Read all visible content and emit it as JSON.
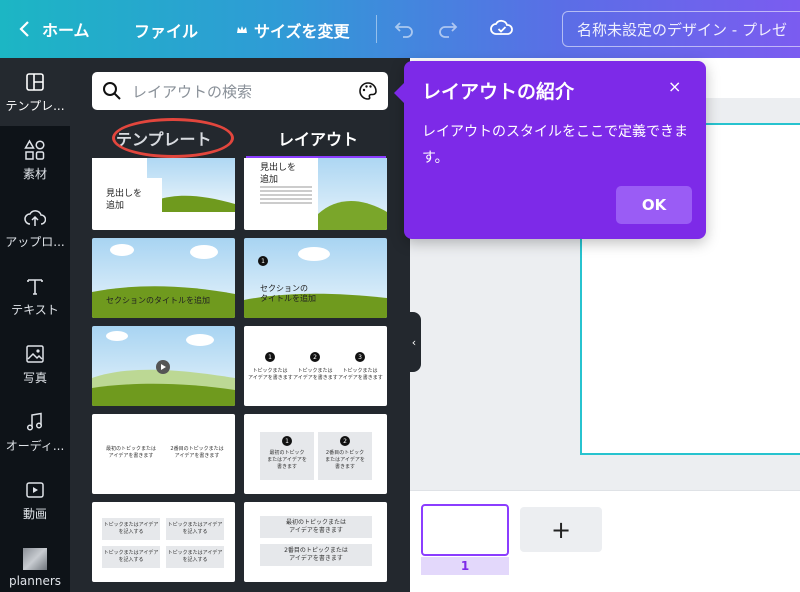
{
  "topbar": {
    "home": "ホーム",
    "file": "ファイル",
    "resize": "サイズを変更",
    "title": "名称未設定のデザイン - プレゼ"
  },
  "nav": {
    "items": [
      {
        "label": "テンプレ...",
        "icon": "layout-icon"
      },
      {
        "label": "素材",
        "icon": "shapes-icon"
      },
      {
        "label": "アップロ...",
        "icon": "upload-cloud-icon"
      },
      {
        "label": "テキスト",
        "icon": "text-icon"
      },
      {
        "label": "写真",
        "icon": "photo-icon"
      },
      {
        "label": "オーディ...",
        "icon": "music-note-icon"
      },
      {
        "label": "動画",
        "icon": "video-icon"
      },
      {
        "label": "planners",
        "icon": "folder-thumbnail"
      }
    ]
  },
  "panel": {
    "search_placeholder": "レイアウトの検索",
    "tab_templates": "テンプレート",
    "tab_layouts": "レイアウト",
    "cards": {
      "c1": "見出しを\n追加",
      "c2": "見出しを\n追加",
      "c3": "セクションのタイトルを追加",
      "c4_num": "1",
      "c4": "セクションの\nタイトルを追加",
      "c6_nums": [
        "1",
        "2",
        "3"
      ],
      "c6_text": "トピックまたは\nアイデアを書きます",
      "c7a": "最初のトピックまたは\nアイデアを書きます",
      "c7b": "2番目のトピックまたは\nアイデアを書きます",
      "c8_nums": [
        "1",
        "2"
      ],
      "c8a": "最初のトピック\nまたはアイデアを\n書きます",
      "c8b": "2番目のトピック\nまたはアイデアを\n書きます",
      "c9": "トピックまたはアイデア\nを記入する",
      "c10a": "最初のトピックまたは\nアイデアを書きます",
      "c10b": "2番目のトピックまたは\nアイデアを書きます"
    }
  },
  "tooltip": {
    "title": "レイアウトの紹介",
    "close": "×",
    "body": "レイアウトのスタイルをここで定義できます。",
    "ok": "OK"
  },
  "pages": {
    "current": "1",
    "add": "+"
  },
  "colors": {
    "accent": "#7d2ae8",
    "highlight": "#e2463d",
    "frame": "#27c3cf"
  }
}
